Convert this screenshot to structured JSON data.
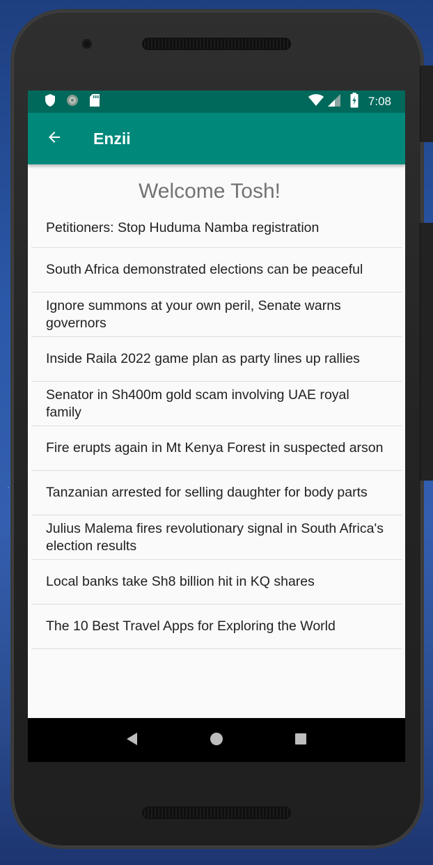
{
  "status_bar": {
    "time": "7:08",
    "left_icons": [
      "shield-icon",
      "sync-icon",
      "sd-card-icon"
    ],
    "right_icons": [
      "wifi-icon",
      "signal-icon",
      "battery-icon"
    ]
  },
  "app_bar": {
    "title": "Enzii",
    "back_icon": "arrow-back-icon"
  },
  "welcome": "Welcome Tosh!",
  "news": [
    "Petitioners: Stop Huduma Namba registration",
    "South Africa demonstrated elections can be peaceful",
    "Ignore summons at your own peril, Senate warns governors",
    "Inside Raila 2022 game plan as party lines up rallies",
    "Senator in Sh400m gold scam involving UAE royal family",
    "Fire erupts again in Mt Kenya Forest in suspected arson",
    "Tanzanian arrested for selling daughter for body parts",
    "Julius Malema fires revolutionary signal in South Africa's election results",
    "Local banks take Sh8 billion hit in KQ shares",
    "The 10 Best Travel Apps for Exploring the World"
  ],
  "nav_bar": [
    "back-triangle-icon",
    "home-circle-icon",
    "recents-square-icon"
  ],
  "colors": {
    "status_bar": "#00695c",
    "app_bar": "#00897b",
    "welcome_text": "#737373"
  }
}
